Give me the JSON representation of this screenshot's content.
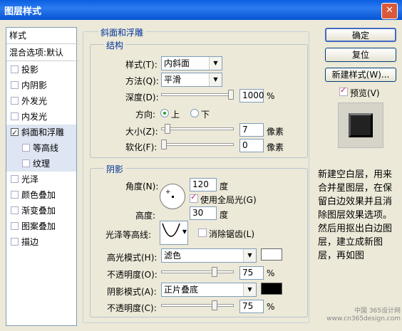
{
  "window": {
    "title": "图层样式",
    "close_glyph": "✕"
  },
  "left_panel": {
    "header": "样式",
    "blend_default": "混合选项:默认",
    "items": [
      {
        "label": "投影",
        "checked": false,
        "sub": false,
        "selected": false
      },
      {
        "label": "内阴影",
        "checked": false,
        "sub": false,
        "selected": false
      },
      {
        "label": "外发光",
        "checked": false,
        "sub": false,
        "selected": false
      },
      {
        "label": "内发光",
        "checked": false,
        "sub": false,
        "selected": false
      },
      {
        "label": "斜面和浮雕",
        "checked": true,
        "sub": false,
        "selected": true
      },
      {
        "label": "等高线",
        "checked": false,
        "sub": true,
        "selected": true
      },
      {
        "label": "纹理",
        "checked": false,
        "sub": true,
        "selected": true
      },
      {
        "label": "光泽",
        "checked": false,
        "sub": false,
        "selected": false
      },
      {
        "label": "颜色叠加",
        "checked": false,
        "sub": false,
        "selected": false
      },
      {
        "label": "渐变叠加",
        "checked": false,
        "sub": false,
        "selected": false
      },
      {
        "label": "图案叠加",
        "checked": false,
        "sub": false,
        "selected": false
      },
      {
        "label": "描边",
        "checked": false,
        "sub": false,
        "selected": false
      }
    ]
  },
  "bevel": {
    "section_title": "斜面和浮雕",
    "structure_title": "结构",
    "style_label": "样式(T):",
    "style_value": "内斜面",
    "method_label": "方法(Q):",
    "method_value": "平滑",
    "depth_label": "深度(D):",
    "depth_value": "1000",
    "depth_unit": "%",
    "depth_level": 1.0,
    "direction_label": "方向:",
    "direction_up": "上",
    "direction_down": "下",
    "size_label": "大小(Z):",
    "size_value": "7",
    "size_unit": "像素",
    "size_level": 0.05,
    "soften_label": "软化(F):",
    "soften_value": "0",
    "soften_unit": "像素",
    "soften_level": 0.0
  },
  "shading": {
    "title": "阴影",
    "angle_label": "角度(N):",
    "angle_value": "120",
    "angle_unit": "度",
    "global_light_label": "使用全局光(G)",
    "altitude_label": "高度:",
    "altitude_value": "30",
    "altitude_unit": "度",
    "gloss_label": "光泽等高线:",
    "antialias_label": "消除锯齿(L)",
    "highlight_mode_label": "高光模式(H):",
    "highlight_mode_value": "滤色",
    "highlight_color": "#ffffff",
    "opacity1_label": "不透明度(O):",
    "opacity1_value": "75",
    "opacity1_unit": "%",
    "opacity1_level": 0.75,
    "shadow_mode_label": "阴影模式(A):",
    "shadow_mode_value": "正片叠底",
    "shadow_color": "#000000",
    "opacity2_label": "不透明度(C):",
    "opacity2_value": "75",
    "opacity2_unit": "%",
    "opacity2_level": 0.75
  },
  "buttons": {
    "ok": "确定",
    "reset": "复位",
    "new_style": "新建样式(W)...",
    "preview_label": "预览(V)"
  },
  "note": "新建空白层，用来合并星图层，在保留白边效果并且消除图层效果选项。然后用抠出白边图层，建立成新图层，再如图",
  "watermark": "中国 365设计网\nwww.cn365design.com"
}
